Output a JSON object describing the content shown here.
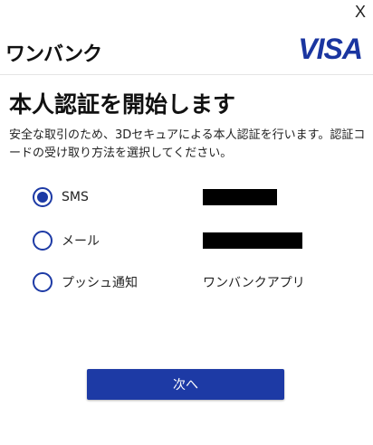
{
  "window": {
    "close_label": "X"
  },
  "header": {
    "brand": "ワンバンク",
    "network": "VISA"
  },
  "main": {
    "title": "本人認証を開始します",
    "description": "安全な取引のため、3Dセキュアによる本人認証を行います。認証コードの受け取り方法を選択してください。",
    "options": [
      {
        "label": "SMS",
        "value": "",
        "selected": true
      },
      {
        "label": "メール",
        "value": "",
        "selected": false
      },
      {
        "label": "プッシュ通知",
        "value": "ワンバンクアプリ",
        "selected": false
      }
    ],
    "next_label": "次へ"
  },
  "colors": {
    "accent": "#1d3aa5",
    "visa": "#1a35a0"
  }
}
